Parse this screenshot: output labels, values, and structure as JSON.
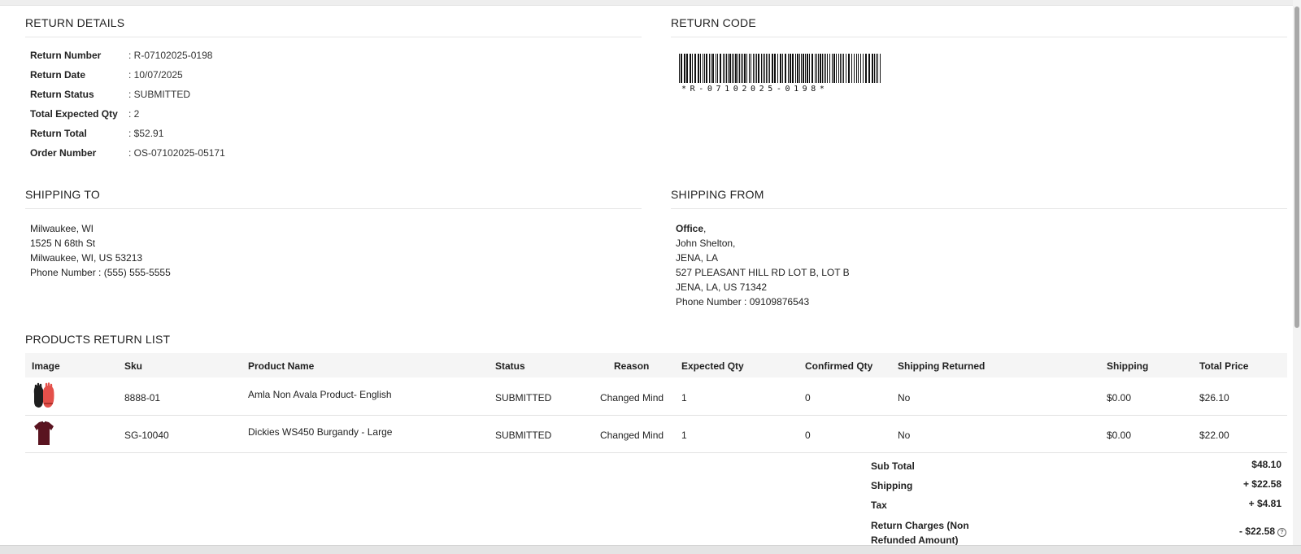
{
  "return_details": {
    "title": "RETURN DETAILS",
    "rows": [
      {
        "label": "Return Number",
        "value": ": R-07102025-0198"
      },
      {
        "label": "Return Date",
        "value": ": 10/07/2025"
      },
      {
        "label": "Return Status",
        "value": ": SUBMITTED"
      },
      {
        "label": "Total Expected Qty",
        "value": ": 2"
      },
      {
        "label": "Return Total",
        "value": ": $52.91"
      },
      {
        "label": "Order Number",
        "value": ": OS-07102025-05171"
      }
    ]
  },
  "return_code": {
    "title": "RETURN CODE",
    "barcode_text": "*R-07102025-0198*"
  },
  "shipping_to": {
    "title": "SHIPPING TO",
    "lines": [
      "Milwaukee, WI",
      "1525 N 68th St",
      "Milwaukee, WI, US 53213",
      "Phone Number : (555) 555-5555"
    ]
  },
  "shipping_from": {
    "title": "SHIPPING FROM",
    "name": "Office",
    "name_suffix": ",",
    "lines": [
      "John Shelton,",
      "JENA, LA",
      "527 PLEASANT HILL RD LOT B, LOT B",
      "JENA, LA, US 71342",
      "Phone Number : 09109876543"
    ]
  },
  "products": {
    "title": "PRODUCTS RETURN LIST",
    "columns": [
      "Image",
      "Sku",
      "Product Name",
      "Status",
      "Reason",
      "Expected Qty",
      "Confirmed Qty",
      "Shipping Returned",
      "Shipping",
      "Total Price"
    ],
    "rows": [
      {
        "image_icon": "gloves-icon",
        "sku": "8888-01",
        "name": "Amla Non Avala Product- English",
        "status": "SUBMITTED",
        "reason": "Changed Mind",
        "expected_qty": "1",
        "confirmed_qty": "0",
        "shipping_returned": "No",
        "shipping": "$0.00",
        "total_price": "$26.10"
      },
      {
        "image_icon": "shirt-icon",
        "sku": "SG-10040",
        "name": "Dickies WS450 Burgandy - Large",
        "status": "SUBMITTED",
        "reason": "Changed Mind",
        "expected_qty": "1",
        "confirmed_qty": "0",
        "shipping_returned": "No",
        "shipping": "$0.00",
        "total_price": "$22.00"
      }
    ]
  },
  "totals": [
    {
      "label": "Sub Total",
      "value": "$48.10"
    },
    {
      "label": "Shipping",
      "value": "+ $22.58"
    },
    {
      "label": "Tax",
      "value": "+ $4.81"
    },
    {
      "label": "Return Charges (Non Refunded Amount)",
      "value": "- $22.58"
    }
  ],
  "colors": {
    "glove_red": "#e4504a",
    "glove_black": "#1e1e1e",
    "shirt_burgundy": "#5a1420",
    "header_bg": "#f5f5f5"
  }
}
